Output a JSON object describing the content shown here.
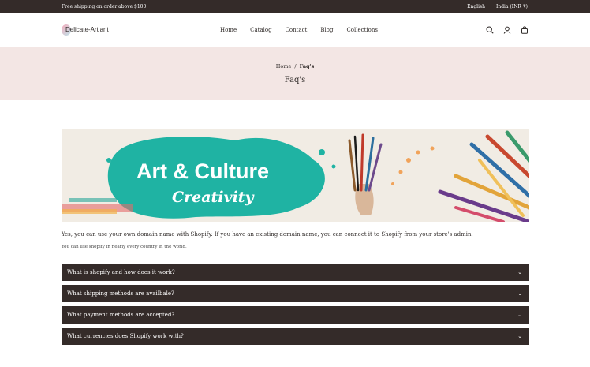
{
  "announcement": {
    "text": "Free shipping on order above $100",
    "language": "English",
    "currency": "India (INR ₹)"
  },
  "header": {
    "logo": "Delicate-Artiant",
    "nav": [
      "Home",
      "Catalog",
      "Contact",
      "Blog",
      "Collections"
    ],
    "icons": [
      "search-icon",
      "account-icon",
      "cart-icon"
    ]
  },
  "hero": {
    "breadcrumb_home": "Home",
    "breadcrumb_sep": "/",
    "breadcrumb_current": "Faq's",
    "title": "Faq's"
  },
  "banner": {
    "title": "Art & Culture",
    "subtitle": "Creativity",
    "splash_color": "#1fb3a3"
  },
  "content": {
    "paragraph": "Yes, you can use your own domain name with Shopify. If you have an existing domain name, you can connect it to Shopify from your store's admin.",
    "note": "You can use shopify in nearly every country in the world."
  },
  "faqs": [
    {
      "question": "What is shopify and how does it work?"
    },
    {
      "question": "What shipping methods are availbale?"
    },
    {
      "question": "What payment methods are accepted?"
    },
    {
      "question": "What currencies does Shopify work with?"
    }
  ]
}
